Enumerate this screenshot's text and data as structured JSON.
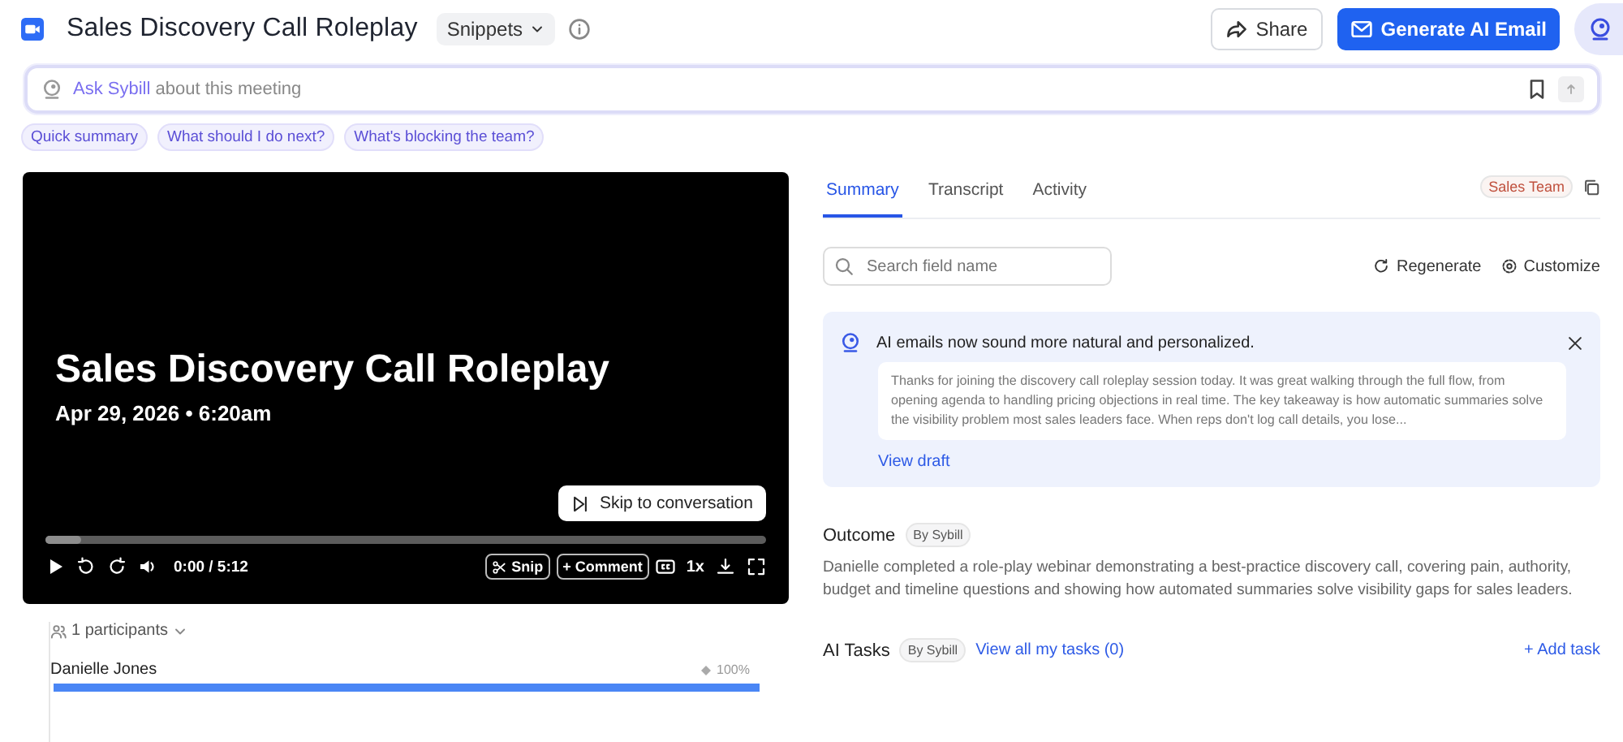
{
  "header": {
    "title": "Sales Discovery Call Roleplay",
    "snippets": "Snippets",
    "share": "Share",
    "generate": "Generate AI Email"
  },
  "ask": {
    "brand": "Ask Sybill",
    "rest": " about this meeting"
  },
  "suggestions": [
    "Quick summary",
    "What should I do next?",
    "What's blocking the team?"
  ],
  "video": {
    "title": "Sales Discovery Call Roleplay",
    "date": "Apr 29, 2026 • 6:20am",
    "skip": "Skip to conversation",
    "level": 0.05,
    "time": "0:00 / 5:12",
    "snip": "Snip",
    "comment": "+ Comment",
    "speed": "1x"
  },
  "participants": {
    "label": "1 participants",
    "people": [
      {
        "name": "Danielle Jones",
        "share": "100%",
        "level": 1
      }
    ]
  },
  "tabs": [
    {
      "label": "Summary",
      "selected": true
    },
    {
      "label": "Transcript",
      "selected": false
    },
    {
      "label": "Activity",
      "selected": false
    }
  ],
  "team_tag": "Sales Team",
  "search": {
    "placeholder": "Search field name"
  },
  "actions": [
    "Regenerate",
    "Customize"
  ],
  "notice": {
    "title": "AI emails now sound more natural and personalized.",
    "draft": "Thanks for joining the discovery call roleplay session today. It was great walking through the full flow, from opening agenda to handling pricing objections in real time. The key takeaway is how automatic summaries solve the visibility problem most sales leaders face. When reps don't log call details, you lose...",
    "link": "View draft"
  },
  "outcome": {
    "title": "Outcome",
    "by": "By Sybill",
    "text": "Danielle completed a role-play webinar demonstrating a best-practice discovery call, covering pain, authority, budget and timeline questions and showing how automated summaries solve visibility gaps for sales leaders."
  },
  "tasks": {
    "title": "AI Tasks",
    "by": "By Sybill",
    "link": "View all my tasks (0)",
    "add": "+ Add task"
  }
}
